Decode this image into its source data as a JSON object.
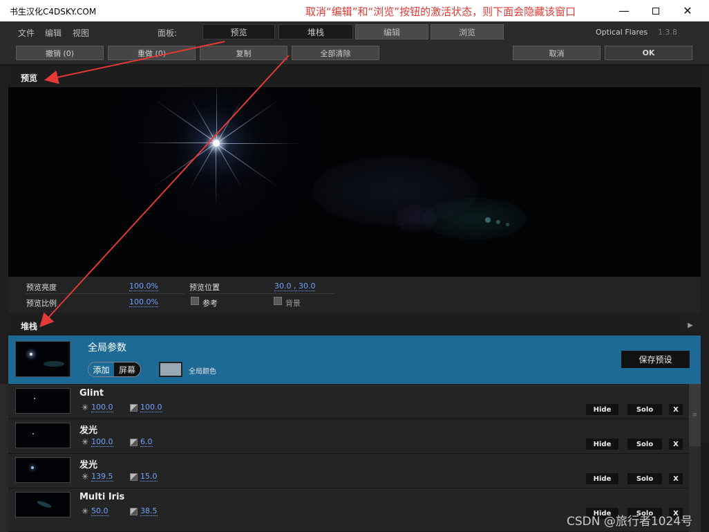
{
  "window": {
    "title": "书生汉化C4DSKY.COM",
    "annotation": "取消“编辑”和“浏览”按钮的激活状态，则下面会隐藏该窗口",
    "controls": {
      "minimize": "—",
      "close": "✕"
    }
  },
  "menubar": {
    "items": [
      "文件",
      "编辑",
      "视图"
    ],
    "panel_label": "面板:",
    "panel_buttons": [
      "预览",
      "堆栈",
      "编辑",
      "浏览"
    ],
    "app_name": "Optical Flares",
    "version": "1.3.8"
  },
  "toolbar": {
    "undo": "撤销 (0)",
    "redo": "重做 (0)",
    "copy": "复制",
    "clear_all": "全部清除",
    "cancel": "取消",
    "ok": "OK"
  },
  "preview": {
    "header": "预览",
    "brightness_label": "预览亮度",
    "brightness_value": "100.0%",
    "position_label": "预览位置",
    "position_value": "30.0 , 30.0",
    "scale_label": "预览比例",
    "scale_value": "100.0%",
    "reference_label": "参考",
    "background_label": "背景"
  },
  "stack": {
    "header": "堆栈",
    "global": {
      "title": "全局参数",
      "mode_add": "添加",
      "mode_screen": "屏幕",
      "color_label": "全局颜色",
      "save_preset": "保存预设",
      "color": "#9aa7b4"
    },
    "layers": [
      {
        "name": "Glint",
        "brightness": "100.0",
        "scale": "100.0",
        "hide": "Hide",
        "solo": "Solo",
        "remove": "X"
      },
      {
        "name": "发光",
        "brightness": "100.0",
        "scale": "6.0",
        "hide": "Hide",
        "solo": "Solo",
        "remove": "X"
      },
      {
        "name": "发光",
        "brightness": "139.5",
        "scale": "15.0",
        "hide": "Hide",
        "solo": "Solo",
        "remove": "X"
      },
      {
        "name": "Multi Iris",
        "brightness": "50.0",
        "scale": "38.5",
        "hide": "Hide",
        "solo": "Solo",
        "remove": "X"
      }
    ]
  },
  "watermark": "CSDN @旅行者1024号",
  "colors": {
    "accent_blue": "#1d6a97",
    "value_blue": "#6fa1ff",
    "annotation_red": "#e53935"
  }
}
